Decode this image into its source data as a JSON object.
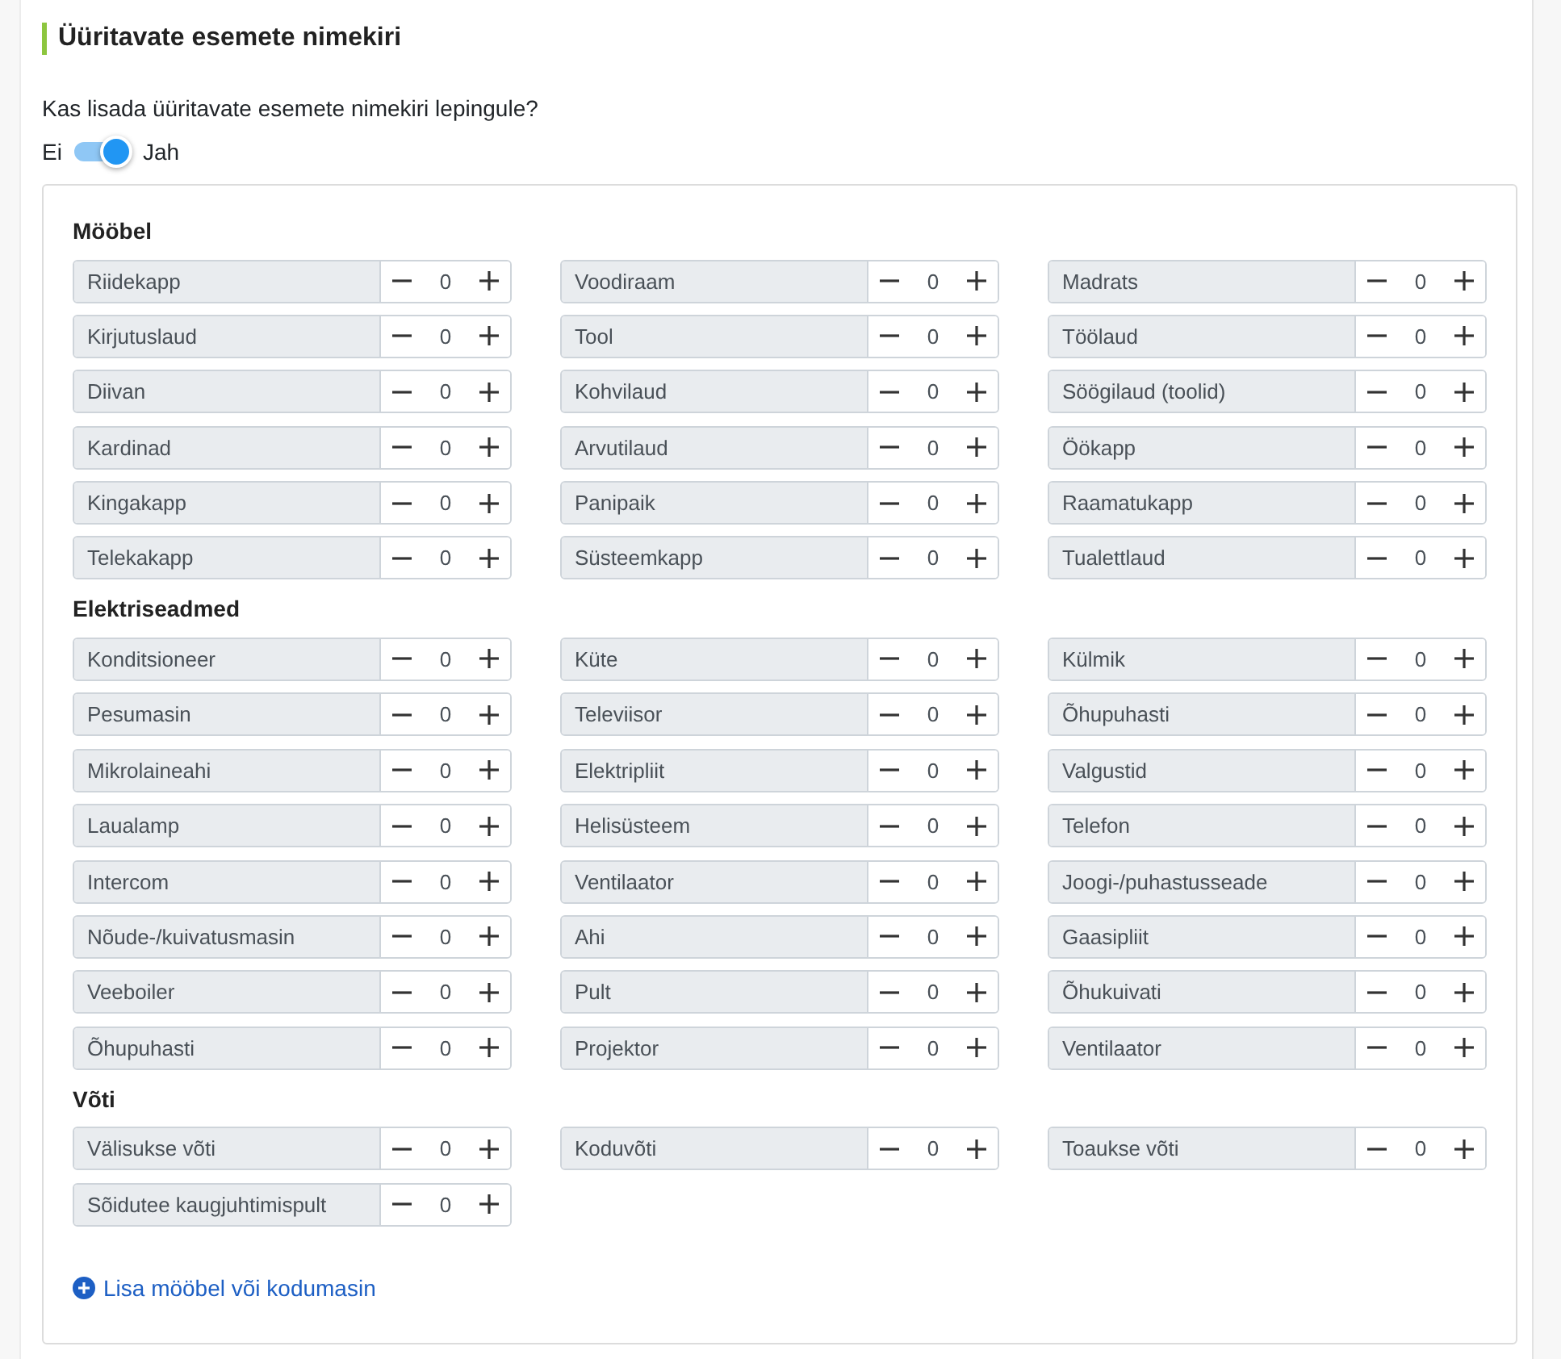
{
  "section": {
    "title": "Üüritavate esemete nimekiri"
  },
  "question": "Kas lisada üüritavate esemete nimekiri lepingule?",
  "toggle": {
    "off_label": "Ei",
    "on_label": "Jah",
    "on": true
  },
  "groups": [
    {
      "title": "Mööbel",
      "items": [
        {
          "name": "Riidekapp",
          "value": "0"
        },
        {
          "name": "Voodiraam",
          "value": "0"
        },
        {
          "name": "Madrats",
          "value": "0"
        },
        {
          "name": "Kirjutuslaud",
          "value": "0"
        },
        {
          "name": "Tool",
          "value": "0"
        },
        {
          "name": "Töölaud",
          "value": "0"
        },
        {
          "name": "Diivan",
          "value": "0"
        },
        {
          "name": "Kohvilaud",
          "value": "0"
        },
        {
          "name": "Söögilaud (toolid)",
          "value": "0"
        },
        {
          "name": "Kardinad",
          "value": "0"
        },
        {
          "name": "Arvutilaud",
          "value": "0"
        },
        {
          "name": "Öökapp",
          "value": "0"
        },
        {
          "name": "Kingakapp",
          "value": "0"
        },
        {
          "name": "Panipaik",
          "value": "0"
        },
        {
          "name": "Raamatukapp",
          "value": "0"
        },
        {
          "name": "Telekakapp",
          "value": "0"
        },
        {
          "name": "Süsteemkapp",
          "value": "0"
        },
        {
          "name": "Tualettlaud",
          "value": "0"
        }
      ]
    },
    {
      "title": "Elektriseadmed",
      "items": [
        {
          "name": "Konditsioneer",
          "value": "0"
        },
        {
          "name": "Küte",
          "value": "0"
        },
        {
          "name": "Külmik",
          "value": "0"
        },
        {
          "name": "Pesumasin",
          "value": "0"
        },
        {
          "name": "Televiisor",
          "value": "0"
        },
        {
          "name": "Õhupuhasti",
          "value": "0"
        },
        {
          "name": "Mikrolaineahi",
          "value": "0"
        },
        {
          "name": "Elektripliit",
          "value": "0"
        },
        {
          "name": "Valgustid",
          "value": "0"
        },
        {
          "name": "Laualamp",
          "value": "0"
        },
        {
          "name": "Helisüsteem",
          "value": "0"
        },
        {
          "name": "Telefon",
          "value": "0"
        },
        {
          "name": "Intercom",
          "value": "0"
        },
        {
          "name": "Ventilaator",
          "value": "0"
        },
        {
          "name": "Joogi-/puhastusseade",
          "value": "0"
        },
        {
          "name": "Nõude-/kuivatusmasin",
          "value": "0"
        },
        {
          "name": "Ahi",
          "value": "0"
        },
        {
          "name": "Gaasipliit",
          "value": "0"
        },
        {
          "name": "Veeboiler",
          "value": "0"
        },
        {
          "name": "Pult",
          "value": "0"
        },
        {
          "name": "Õhukuivati",
          "value": "0"
        },
        {
          "name": "Õhupuhasti",
          "value": "0"
        },
        {
          "name": "Projektor",
          "value": "0"
        },
        {
          "name": "Ventilaator",
          "value": "0"
        }
      ]
    },
    {
      "title": "Võti",
      "items": [
        {
          "name": "Välisukse võti",
          "value": "0"
        },
        {
          "name": "Koduvõti",
          "value": "0"
        },
        {
          "name": "Toaukse võti",
          "value": "0"
        },
        {
          "name": "Sõidutee kaugjuhtimispult",
          "value": "0"
        }
      ]
    }
  ],
  "add_link": "Lisa mööbel või kodumasin"
}
